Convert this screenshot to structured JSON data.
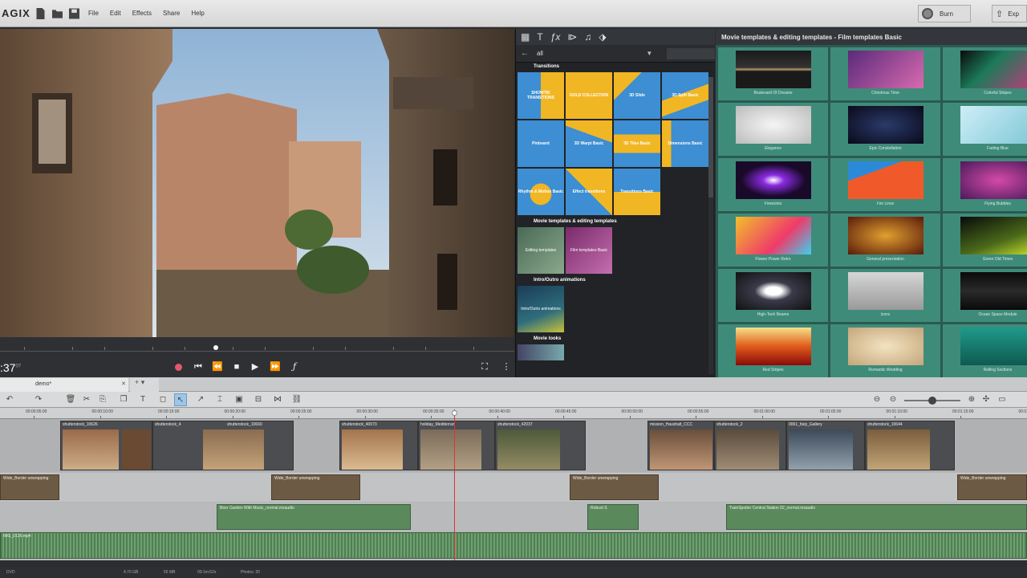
{
  "app": {
    "logo": "AGIX"
  },
  "menu": {
    "items": [
      "File",
      "Edit",
      "Effects",
      "Share",
      "Help"
    ],
    "burn": "Burn",
    "export": "Exp"
  },
  "transport": {
    "timecode": ":37",
    "timecode_frames": "07"
  },
  "media_pool": {
    "filter": "all",
    "sections": {
      "transitions": "Transitions",
      "movie_templates": "Movie templates & editing templates",
      "intro_outro": "Intro/Outro animations",
      "movie_looks": "Movie looks"
    },
    "transition_tiles": [
      "SHOWTIK TRANSITIONS",
      "GOLD COLLECTION",
      "3D Slide",
      "3D Split Basic",
      "Pinboard",
      "3D Warpt Basic",
      "3D Tiles Basic",
      "Dimensions Basic",
      "Rhythm & Motion Basic",
      "Effect transitions",
      "Transitions Basic",
      ""
    ],
    "movie_tiles": [
      "Editing templates",
      "Film templates Basic"
    ],
    "intro_tiles": [
      "Intro/Outro animations"
    ]
  },
  "templates": {
    "header": "Movie templates & editing templates - Film templates Basic",
    "items": [
      "Boulevard Of Dreams",
      "Christmas Time",
      "Colorful Stripes",
      "Elegance",
      "Epic Constellation",
      "Fading Blue",
      "Fireworks",
      "Fire Lines",
      "Flying Bubbles",
      "Flower Power Retro",
      "General presentation",
      "Green Old Times",
      "High-Tech Beams",
      "Icons",
      "Ocean Space Module",
      "Red Stripes",
      "Romantic Wedding",
      "Rolling Sections"
    ]
  },
  "timeline": {
    "tab": "demo*",
    "ruler": [
      "00:00:05:00",
      "00:00:10:00",
      "00:00:15:00",
      "00:00:20:00",
      "00:00:25:00",
      "00:00:30:00",
      "00:00:35:00",
      "00:00:40:00",
      "00:00:45:00",
      "00:00:50:00",
      "00:00:55:00",
      "00:01:00:00",
      "00:01:05:00",
      "00:01:10:00",
      "00:01:15:00",
      "00:01:20:00"
    ],
    "video_clips": [
      "shutterstock_10626",
      "shutterstock_4",
      "shutterstock_10660",
      "shutterstock_40073",
      "holiday_Mediterran",
      "shutterstock_42037",
      "mission_Haushalt_CCC",
      "shutterstock_2",
      "0061_Italy_Gallery",
      "shutterstock_10644"
    ],
    "transitions": [
      "Wide_Border unwrapping",
      "Wide_Border unwrapping",
      "Wide_Border unwrapping",
      "Wide_Border unwrapping"
    ],
    "audio_clips": [
      "Beer Garden With Music_normal.mxaudio",
      "Robust S",
      "TrainSpotter Central Station 02_normal.mxaudio"
    ],
    "music": "IMG_0126.mp4"
  },
  "status": [
    "DVD",
    "4.70 GB",
    "55 MB",
    "00:1m:52s",
    "Photos: 20"
  ]
}
